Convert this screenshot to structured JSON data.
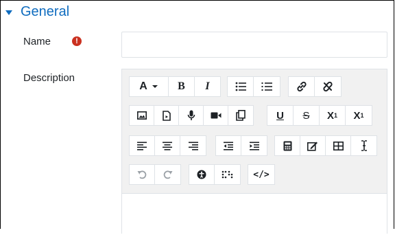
{
  "section": {
    "title": "General"
  },
  "fields": {
    "name_label": "Name",
    "required_symbol": "!",
    "name_value": "",
    "description_label": "Description"
  },
  "editor": {
    "toolbar": {
      "font_size_label": "A",
      "bold_label": "B",
      "italic_label": "I",
      "underline_label": "U",
      "strike_label": "S",
      "subscript_label": "X",
      "subscript_mark": "1",
      "superscript_label": "X",
      "superscript_mark": "1",
      "html_label": "</>"
    },
    "icons": [
      "caret-down-icon",
      "bold-icon",
      "italic-icon",
      "unordered-list-icon",
      "ordered-list-icon",
      "link-icon",
      "unlink-icon",
      "image-icon",
      "media-icon",
      "record-audio-icon",
      "record-video-icon",
      "manage-files-icon",
      "underline-icon",
      "strikethrough-icon",
      "subscript-icon",
      "superscript-icon",
      "align-left-icon",
      "align-center-icon",
      "align-right-icon",
      "outdent-icon",
      "indent-icon",
      "equation-icon",
      "special-character-icon",
      "table-icon",
      "clear-formatting-icon",
      "undo-icon",
      "redo-icon",
      "accessibility-checker-icon",
      "screenreader-helper-icon",
      "html-icon"
    ],
    "content": ""
  },
  "colors": {
    "accent": "#0f6cbf",
    "required": "#ca3120",
    "toolbar_bg": "#f1f1f1",
    "border": "#dee2e6"
  }
}
